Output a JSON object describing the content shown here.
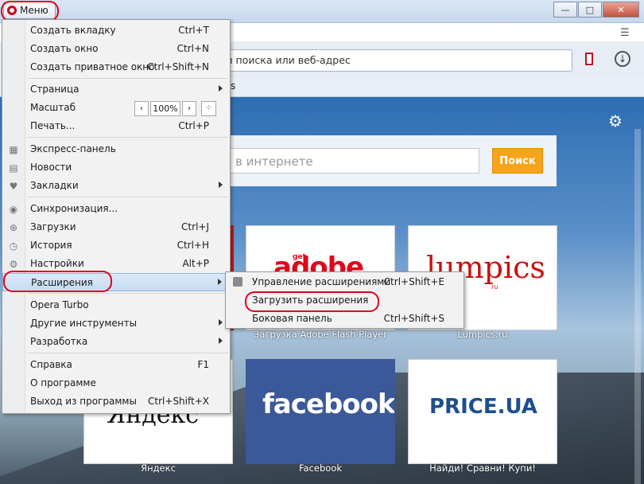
{
  "window": {
    "menu_button_label": "Меню",
    "controls": [
      "minimize",
      "maximize",
      "close"
    ]
  },
  "toolbar": {
    "address_placeholder_partial": "я поиска или веб-адрес",
    "bookmarks_bar_partial": "ks"
  },
  "speed_dial": {
    "search_placeholder_partial": "в интернете",
    "search_button": "Поиск",
    "tiles": [
      {
        "logo_text": "adobe",
        "logo_prefix": "get",
        "caption": "Загрузка Adobe Flash Player"
      },
      {
        "logo_text": "lumpics",
        "logo_suffix": "ru",
        "caption": "Lumpics.ru"
      },
      {
        "logo_text": "Яндекс",
        "caption": "Яндекс"
      },
      {
        "logo_text": "facebook",
        "caption": "Facebook"
      },
      {
        "logo_text": "PRICE.UA",
        "caption": "Найди! Сравни! Купи!"
      }
    ]
  },
  "menu": {
    "items": [
      {
        "label": "Создать вкладку",
        "shortcut": "Ctrl+T"
      },
      {
        "label": "Создать окно",
        "shortcut": "Ctrl+N"
      },
      {
        "label": "Создать приватное окно",
        "shortcut": "Ctrl+Shift+N"
      },
      {
        "label": "Страница",
        "shortcut": ""
      },
      {
        "label": "Масштаб",
        "shortcut": ""
      },
      {
        "label": "Печать...",
        "shortcut": "Ctrl+P"
      },
      {
        "label": "Экспресс-панель",
        "shortcut": ""
      },
      {
        "label": "Новости",
        "shortcut": ""
      },
      {
        "label": "Закладки",
        "shortcut": ""
      },
      {
        "label": "Синхронизация...",
        "shortcut": ""
      },
      {
        "label": "Загрузки",
        "shortcut": "Ctrl+J"
      },
      {
        "label": "История",
        "shortcut": "Ctrl+H"
      },
      {
        "label": "Настройки",
        "shortcut": "Alt+P"
      },
      {
        "label": "Расширения",
        "shortcut": ""
      },
      {
        "label": "Opera Turbo",
        "shortcut": ""
      },
      {
        "label": "Другие инструменты",
        "shortcut": ""
      },
      {
        "label": "Разработка",
        "shortcut": ""
      },
      {
        "label": "Справка",
        "shortcut": "F1"
      },
      {
        "label": "О программе",
        "shortcut": ""
      },
      {
        "label": "Выход из программы",
        "shortcut": "Ctrl+Shift+X"
      }
    ],
    "zoom_value": "100%"
  },
  "submenu": {
    "items": [
      {
        "label": "Управление расширениями",
        "shortcut": "Ctrl+Shift+E"
      },
      {
        "label": "Загрузить расширения",
        "shortcut": ""
      },
      {
        "label": "Боковая панель",
        "shortcut": "Ctrl+Shift+S"
      }
    ]
  }
}
